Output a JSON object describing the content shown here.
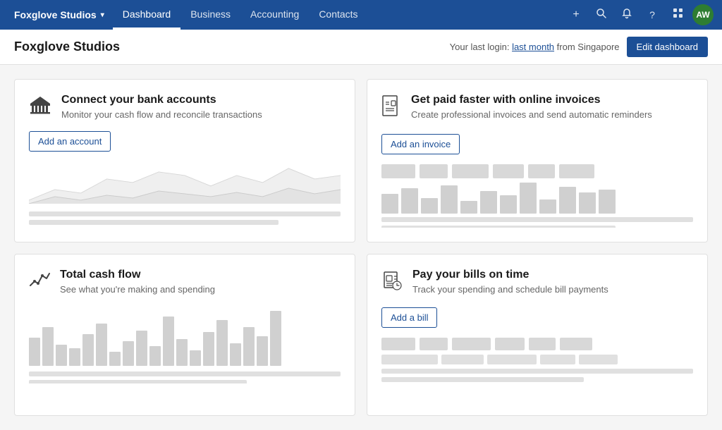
{
  "app": {
    "brand": "Foxglove Studios",
    "brand_caret": "▾"
  },
  "nav": {
    "links": [
      {
        "label": "Dashboard",
        "active": true
      },
      {
        "label": "Business",
        "active": false
      },
      {
        "label": "Accounting",
        "active": false
      },
      {
        "label": "Contacts",
        "active": false
      }
    ]
  },
  "topnav_icons": {
    "add": "+",
    "search": "🔍",
    "bell": "🔔",
    "help": "?",
    "grid": "⊞",
    "avatar": "AW"
  },
  "subheader": {
    "title": "Foxglove Studios",
    "login_prefix": "Your last login: ",
    "login_link": "last month",
    "login_suffix": " from Singapore",
    "edit_button": "Edit dashboard"
  },
  "cards": [
    {
      "id": "bank",
      "title": "Connect your bank accounts",
      "subtitle": "Monitor your cash flow and reconcile transactions",
      "action_label": "Add an account",
      "type": "mountain"
    },
    {
      "id": "invoices",
      "title": "Get paid faster with online invoices",
      "subtitle": "Create professional invoices and send automatic reminders",
      "action_label": "Add an invoice",
      "type": "invoice"
    },
    {
      "id": "cashflow",
      "title": "Total cash flow",
      "subtitle": "See what you're making and spending",
      "action_label": null,
      "type": "bars"
    },
    {
      "id": "bills",
      "title": "Pay your bills on time",
      "subtitle": "Track your spending and schedule bill payments",
      "action_label": "Add a bill",
      "type": "bill"
    }
  ]
}
